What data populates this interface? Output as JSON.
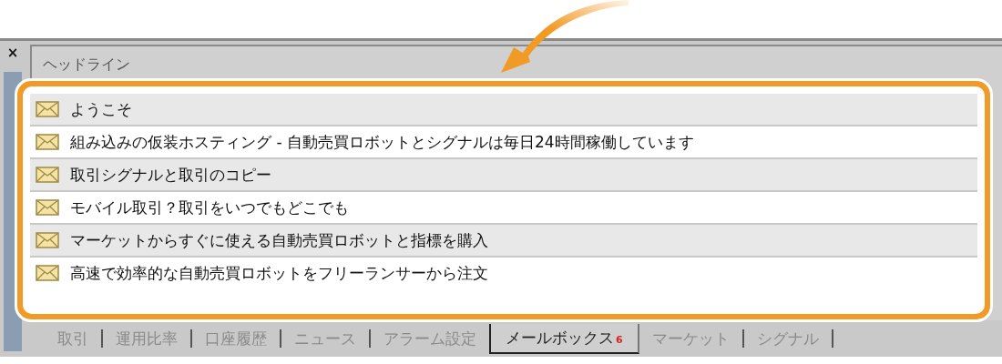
{
  "window": {
    "close": "×"
  },
  "header": "ヘッドライン",
  "messages": [
    {
      "subject": "ようこそ"
    },
    {
      "subject": "組み込みの仮装ホスティング - 自動売買ロボットとシグナルは毎日24時間稼働しています"
    },
    {
      "subject": "取引シグナルと取引のコピー"
    },
    {
      "subject": "モバイル取引？取引をいつでもどこでも"
    },
    {
      "subject": "マーケットからすぐに使える自動売買ロボットと指標を購入"
    },
    {
      "subject": "高速で効率的な自動売買ロボットをフリーランサーから注文"
    }
  ],
  "tabs": [
    {
      "label": "取引",
      "selected": false
    },
    {
      "label": "運用比率",
      "selected": false
    },
    {
      "label": "口座履歴",
      "selected": false
    },
    {
      "label": "ニュース",
      "selected": false
    },
    {
      "label": "アラーム設定",
      "selected": false
    },
    {
      "label": "メールボックス",
      "selected": true,
      "badge": "6"
    },
    {
      "label": "マーケット",
      "selected": false
    },
    {
      "label": "シグナル",
      "selected": false
    }
  ]
}
